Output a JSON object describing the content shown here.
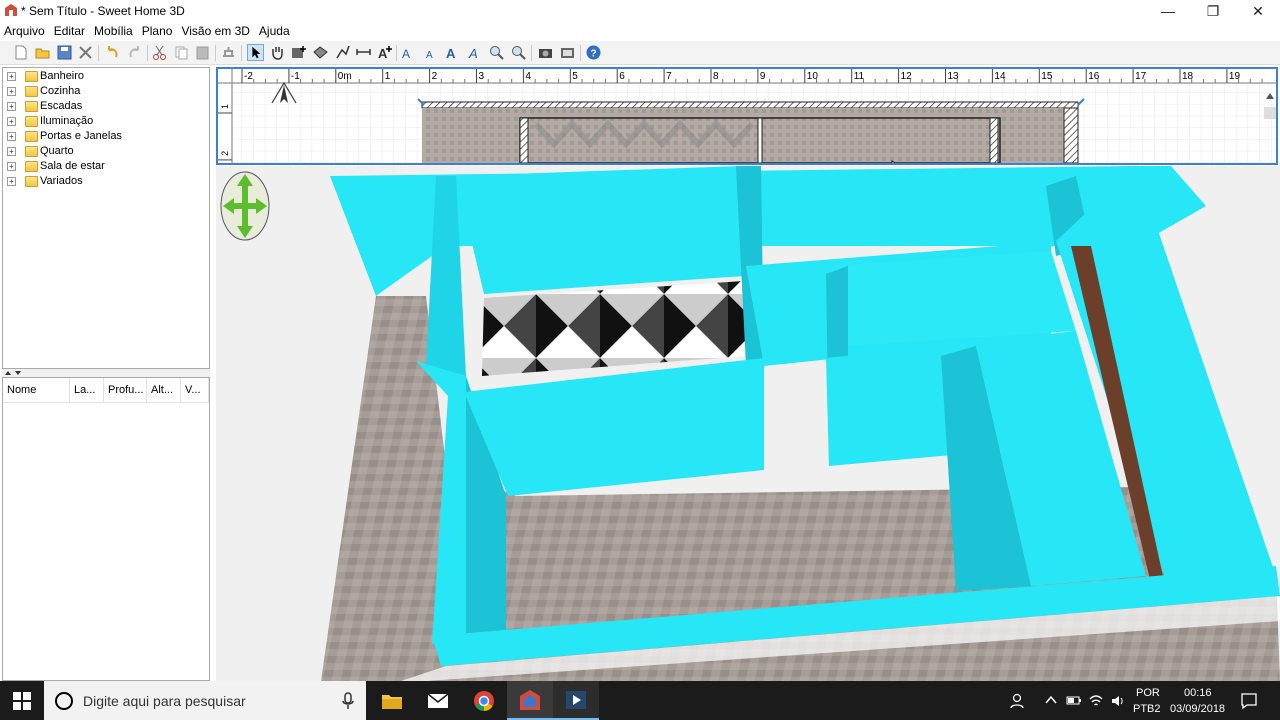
{
  "window": {
    "title": "* Sem Título - Sweet Home 3D",
    "minimize_glyph": "—",
    "maximize_glyph": "❐",
    "close_glyph": "✕"
  },
  "menu": [
    "Arquivo",
    "Editar",
    "Mobília",
    "Plano",
    "Visão em 3D",
    "Ajuda"
  ],
  "toolbar_icons": [
    "new-icon",
    "open-icon",
    "save-icon",
    "cut-icon",
    "undo-icon",
    "redo-icon",
    "copy-icon",
    "paste-icon",
    "add-furniture-icon",
    "select-icon",
    "pan-icon",
    "create-walls-icon",
    "create-rooms-icon",
    "create-polylines-icon",
    "create-dimensions-icon",
    "add-text-icon",
    "increase-text-icon",
    "decrease-text-icon",
    "bold-icon",
    "italic-icon",
    "zoom-in-icon",
    "zoom-out-icon",
    "camera-icon",
    "create-photo-icon",
    "help-icon"
  ],
  "catalog": {
    "categories": [
      "Banheiro",
      "Cozinha",
      "Escadas",
      "Iluminação",
      "Portas e Janelas",
      "Quarto",
      "Sala de estar",
      "Variados"
    ]
  },
  "furniture_table": {
    "columns": [
      "Nome",
      "La...",
      "Profu...",
      "Alt...",
      "V..."
    ]
  },
  "plan": {
    "ruler_x": [
      "-2",
      "-1",
      "0m",
      "1",
      "2",
      "3",
      "4",
      "5",
      "6",
      "7",
      "8",
      "9",
      "10",
      "11",
      "12",
      "13",
      "14",
      "15",
      "16",
      "17",
      "18",
      "19"
    ],
    "ruler_y": [
      "1",
      "2"
    ]
  },
  "taskbar": {
    "search_placeholder": "Digite aqui para pesquisar",
    "lang_top": "POR",
    "lang_bottom": "PTB2",
    "time": "00:16",
    "date": "03/09/2018"
  },
  "colors": {
    "wall": "#27e6f5",
    "wall_dark": "#1cc2d6",
    "floor": "#a8a09c",
    "accent": "#3d7fd0"
  }
}
